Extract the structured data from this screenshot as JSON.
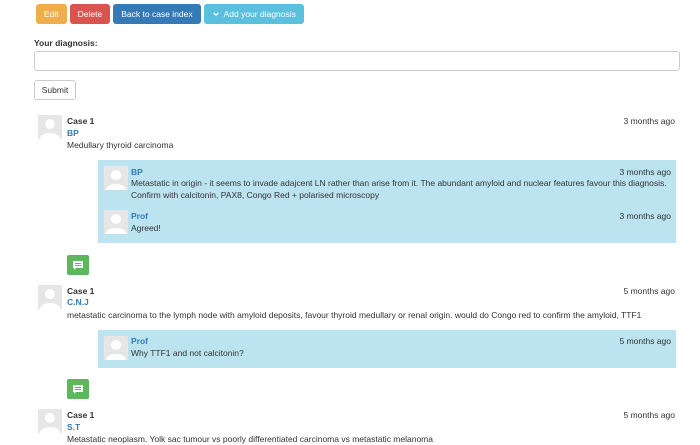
{
  "toolbar": {
    "edit_label": "Edit",
    "delete_label": "Delete",
    "back_label": "Back to case index",
    "add_diagnosis_label": "Add your diagnosis"
  },
  "diagnosis_form": {
    "label": "Your diagnosis:",
    "input_value": "",
    "submit_label": "Submit"
  },
  "threads": [
    {
      "case": "Case 1",
      "author": "BP",
      "time": "3 months ago",
      "text": "Medullary thyroid carcinoma",
      "replies": [
        {
          "author": "BP",
          "time": "3 months ago",
          "text": "Metastatic in origin - it seems to invade adajcent LN rather than arise from it. The abundant amyloid and nuclear features favour this diagnosis. Confirm with calcitonin, PAX8, Congo Red + polarised microscopy"
        },
        {
          "author": "Prof",
          "time": "3 months ago",
          "text": "Agreed!"
        }
      ]
    },
    {
      "case": "Case 1",
      "author": "C.N.J",
      "time": "5 months ago",
      "text": "metastatic carcinoma to the lymph node with amyloid deposits, favour thyroid medullary or renal origin. would do Congo red to confirm the amyloid, TTF1",
      "replies": [
        {
          "author": "Prof",
          "time": "5 months ago",
          "text": "Why TTF1 and not calcitonin?"
        }
      ]
    },
    {
      "case": "Case 1",
      "author": "S.T",
      "time": "5 months ago",
      "text": "Metastatic neoplasm. Yolk sac tumour vs poorly differentiated carcinoma vs metastatic melanoma",
      "replies": []
    }
  ],
  "icons": {
    "comment": "comment-icon",
    "avatar": "default-avatar-icon",
    "chevron": "chevron-down-icon"
  },
  "colors": {
    "edit": "#f0ad4e",
    "delete": "#d9534f",
    "primary": "#337ab7",
    "info": "#5bc0de",
    "reply_bg": "#bce4f0",
    "success": "#5cb85c"
  }
}
